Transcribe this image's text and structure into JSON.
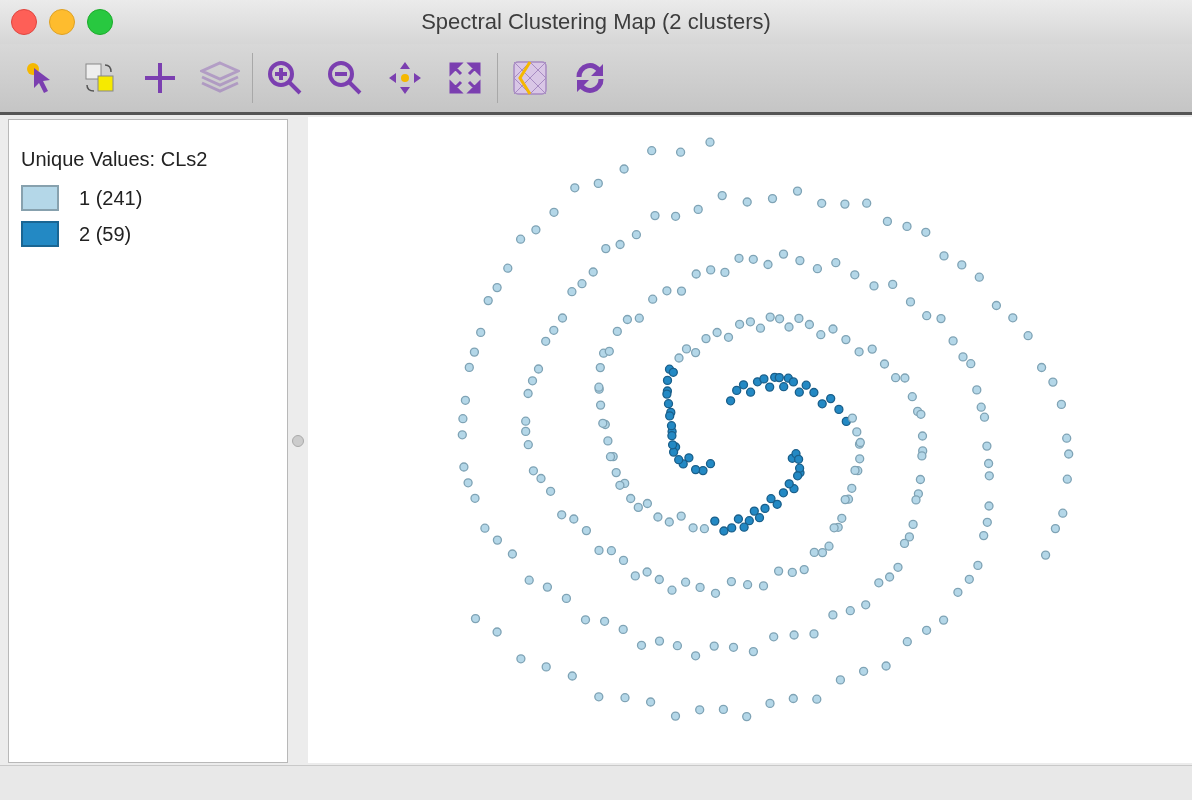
{
  "window": {
    "title": "Spectral Clustering Map (2 clusters)"
  },
  "toolbar": [
    {
      "kind": "select",
      "disabled": false
    },
    {
      "kind": "copy",
      "disabled": false
    },
    {
      "kind": "add",
      "disabled": false
    },
    {
      "kind": "layers",
      "disabled": true
    },
    {
      "kind": "separator"
    },
    {
      "kind": "zoom-in",
      "disabled": false
    },
    {
      "kind": "zoom-out",
      "disabled": false
    },
    {
      "kind": "pan",
      "disabled": false
    },
    {
      "kind": "extent",
      "disabled": false
    },
    {
      "kind": "separator"
    },
    {
      "kind": "basemap",
      "disabled": false
    },
    {
      "kind": "refresh",
      "disabled": false
    }
  ],
  "legend": {
    "title": "Unique Values: CLs2",
    "items": [
      {
        "label": "1 (241)",
        "color": "#b4d7e8"
      },
      {
        "label": "2 (59)",
        "color": "#2389c4"
      }
    ]
  }
}
